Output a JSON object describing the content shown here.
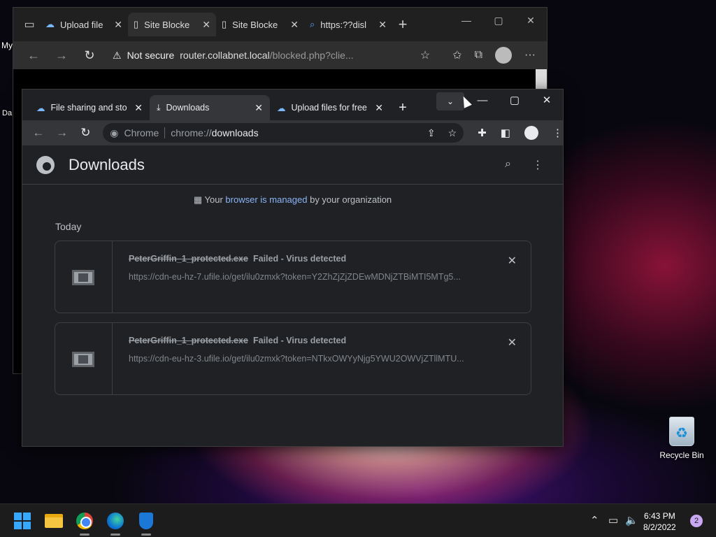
{
  "desktop": {
    "partial_icon_1": "My",
    "partial_icon_2": "Da",
    "recycle_bin": "Recycle Bin"
  },
  "edge": {
    "tabs": [
      {
        "label": "Upload file",
        "icon": "cloud-icon"
      },
      {
        "label": "Site Blocke",
        "icon": "page-icon",
        "active": true
      },
      {
        "label": "Site Blocke",
        "icon": "page-icon"
      },
      {
        "label": "https:??disl",
        "icon": "search-icon"
      }
    ],
    "security": "Not secure",
    "url_host": "router.collabnet.local",
    "url_path": "/blocked.php?clie..."
  },
  "chrome": {
    "tabs": [
      {
        "label": "File sharing and sto",
        "icon": "cloud-icon"
      },
      {
        "label": "Downloads",
        "icon": "download-icon",
        "active": true
      },
      {
        "label": "Upload files for free",
        "icon": "cloud-icon"
      }
    ],
    "omnibox": {
      "site": "Chrome",
      "url_scheme": "chrome://",
      "url_page": "downloads"
    },
    "page_title": "Downloads",
    "managed": {
      "prefix": "Your",
      "link": "browser is managed",
      "suffix": "by your organization"
    },
    "section": "Today",
    "downloads": [
      {
        "filename": "PeterGriffin_1_protected.exe",
        "status": "Failed - Virus detected",
        "url": "https://cdn-eu-hz-7.ufile.io/get/ilu0zmxk?token=Y2ZhZjZjZDEwMDNjZTBiMTI5MTg5..."
      },
      {
        "filename": "PeterGriffin_1_protected.exe",
        "status": "Failed - Virus detected",
        "url": "https://cdn-eu-hz-3.ufile.io/get/ilu0zmxk?token=NTkxOWYyNjg5YWU2OWVjZTllMTU..."
      }
    ]
  },
  "taskbar": {
    "time": "6:43 PM",
    "date": "8/2/2022",
    "notifications": "2"
  }
}
